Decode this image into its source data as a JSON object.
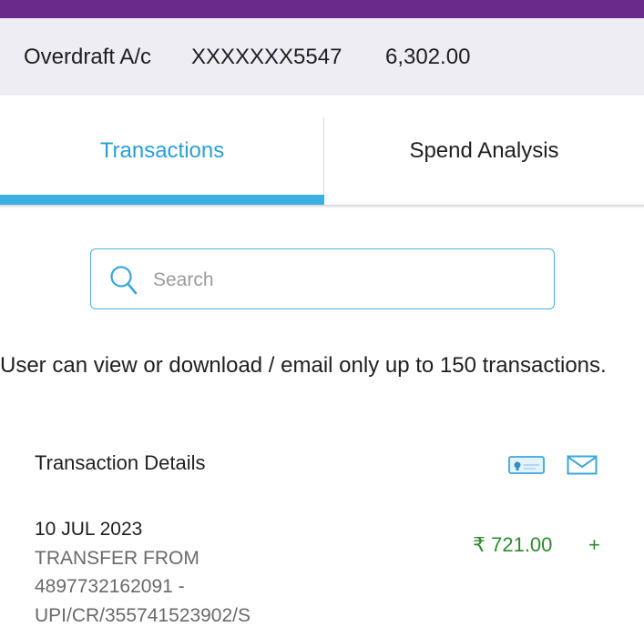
{
  "account": {
    "type": "Overdraft A/c",
    "number": "XXXXXXX5547",
    "balance": "6,302.00"
  },
  "tabs": [
    {
      "label": "Transactions",
      "active": true
    },
    {
      "label": "Spend Analysis",
      "active": false
    }
  ],
  "search": {
    "placeholder": "Search",
    "value": "",
    "icon": "search-icon"
  },
  "notice": "User can view or download / email only up to 150 transactions.",
  "details": {
    "header": "Transaction Details",
    "actions": [
      "statement-icon",
      "email-icon"
    ]
  },
  "transactions": [
    {
      "date": "10 JUL 2023",
      "lines": [
        "TRANSFER FROM",
        "4897732162091 -",
        "UPI/CR/355741523902/S"
      ],
      "amount": "₹ 721.00",
      "sign": "+"
    }
  ],
  "colors": {
    "header_purple": "#6a2a8c",
    "account_bar_bg": "#eeedf4",
    "active_tab_text": "#2a9fd6",
    "active_tab_underline": "#3aafe0",
    "credit_green": "#2e8b2e"
  }
}
